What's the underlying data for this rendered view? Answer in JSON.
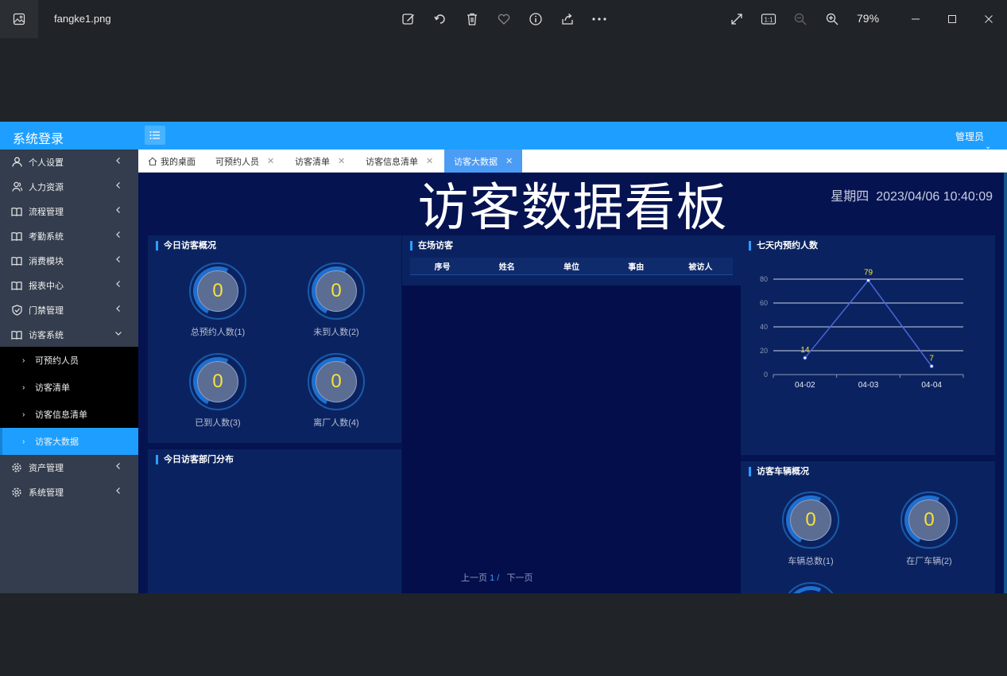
{
  "viewer": {
    "filename": "fangke1.png",
    "zoom": "79%",
    "icons": [
      "edit-icon",
      "rotate-icon",
      "delete-icon",
      "favorite-icon",
      "info-icon",
      "share-icon",
      "more-icon",
      "fullscreen-icon",
      "actual-size-icon",
      "zoom-out-icon",
      "zoom-in-icon",
      "minimize-icon",
      "maximize-icon",
      "close-icon"
    ],
    "actual_size_label": "1:1"
  },
  "app": {
    "brand": "系统登录",
    "user": "管理员",
    "accent": "#1e9fff"
  },
  "sidebar": {
    "items": [
      {
        "label": "个人设置",
        "icon": "user-icon"
      },
      {
        "label": "人力资源",
        "icon": "users-icon"
      },
      {
        "label": "流程管理",
        "icon": "book-icon"
      },
      {
        "label": "考勤系统",
        "icon": "book-icon"
      },
      {
        "label": "消费模块",
        "icon": "book-icon"
      },
      {
        "label": "报表中心",
        "icon": "book-icon"
      },
      {
        "label": "门禁管理",
        "icon": "shield-icon"
      },
      {
        "label": "访客系统",
        "icon": "book-icon",
        "expanded": true
      },
      {
        "label": "资产管理",
        "icon": "gear-icon"
      },
      {
        "label": "系统管理",
        "icon": "gear-icon"
      }
    ],
    "sub_items": [
      "可预约人员",
      "访客清单",
      "访客信息清单",
      "访客大数据"
    ],
    "active_sub": "访客大数据"
  },
  "tabs": [
    "我的桌面",
    "可预约人员",
    "访客清单",
    "访客信息清单",
    "访客大数据"
  ],
  "dashboard": {
    "title": "访客数据看板",
    "weekday": "星期四",
    "datetime": "2023/04/06 10:40:09",
    "today_overview": {
      "title": "今日访客概况",
      "gauges": [
        {
          "value": "0",
          "label": "总预约人数(1)"
        },
        {
          "value": "0",
          "label": "未到人数(2)"
        },
        {
          "value": "0",
          "label": "已到人数(3)"
        },
        {
          "value": "0",
          "label": "离厂人数(4)"
        }
      ]
    },
    "departments": {
      "title": "今日访客部门分布"
    },
    "on_site": {
      "title": "在场访客",
      "columns": [
        "序号",
        "姓名",
        "单位",
        "事由",
        "被访人"
      ],
      "pager": {
        "prev": "上一页",
        "page": "1 /",
        "next": "下一页"
      }
    },
    "vehicles": {
      "title": "访客车辆概况",
      "gauges": [
        {
          "value": "0",
          "label": "车辆总数(1)"
        },
        {
          "value": "0",
          "label": "在厂车辆(2)"
        }
      ]
    }
  },
  "chart_data": {
    "type": "line",
    "title": "七天内预约人数",
    "categories": [
      "04-02",
      "04-03",
      "04-04"
    ],
    "values": [
      14,
      79,
      7
    ],
    "y_ticks": [
      0,
      20,
      40,
      60,
      80
    ],
    "ylim": [
      0,
      90
    ],
    "grid": true,
    "line_color": "#4a66d6",
    "label_color": "#f5e23a"
  }
}
